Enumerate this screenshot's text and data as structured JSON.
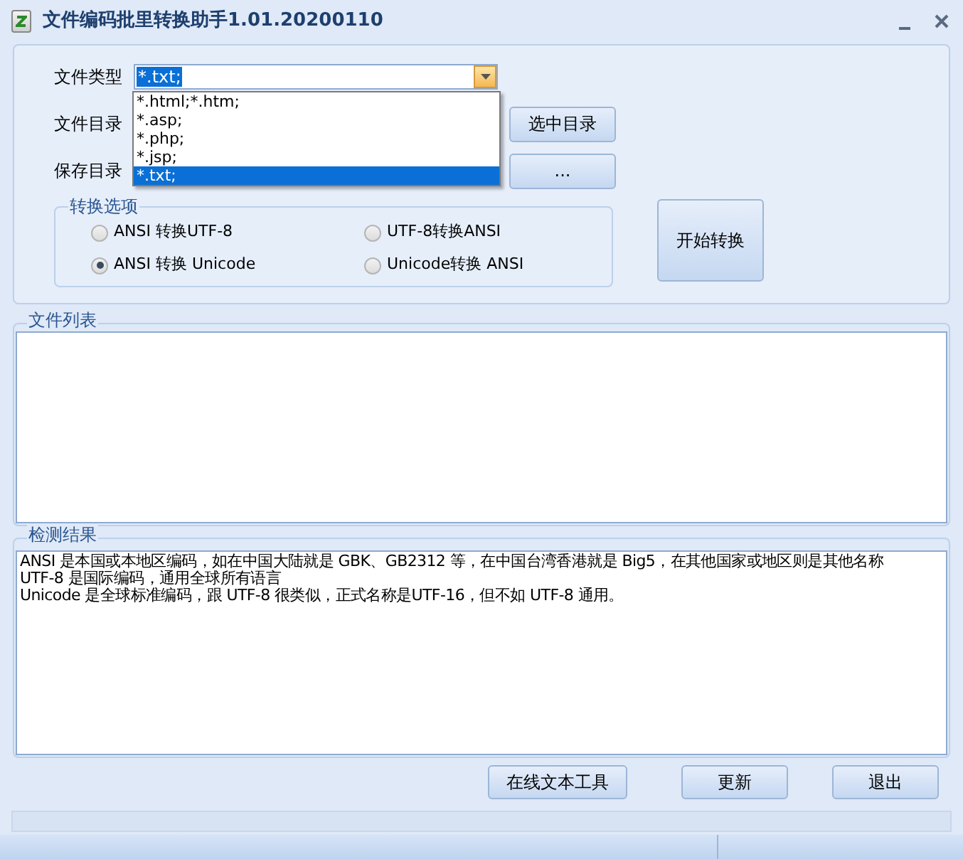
{
  "window": {
    "title": "文件编码批里转换助手1.01.20200110"
  },
  "file_type": {
    "label": "文件类型",
    "value": "*.txt;",
    "dropdown": [
      {
        "label": "*.html;*.htm;",
        "selected": false
      },
      {
        "label": "*.asp;",
        "selected": false
      },
      {
        "label": "*.php;",
        "selected": false
      },
      {
        "label": "*.jsp;",
        "selected": false
      },
      {
        "label": "*.txt;",
        "selected": true
      }
    ]
  },
  "file_dir": {
    "label": "文件目录",
    "button": "选中目录"
  },
  "save_dir": {
    "label": "保存目录",
    "button": "..."
  },
  "options": {
    "title": "转换选项",
    "radios": [
      {
        "label": "ANSI 转换UTF-8",
        "selected": false
      },
      {
        "label": "UTF-8转换ANSI",
        "selected": false
      },
      {
        "label": "ANSI 转换 Unicode",
        "selected": true
      },
      {
        "label": "Unicode转换 ANSI",
        "selected": false
      }
    ]
  },
  "start_button": "开始转换",
  "file_list": {
    "title": "文件列表"
  },
  "results": {
    "title": "检测结果",
    "lines": [
      "ANSI 是本国或本地区编码，如在中国大陆就是 GBK、GB2312 等，在中国台湾香港就是 Big5，在其他国家或地区则是其他名称",
      "UTF-8 是国际编码，通用全球所有语言",
      "Unicode 是全球标准编码，跟 UTF-8 很类似，正式名称是UTF-16，但不如 UTF-8 通用。"
    ]
  },
  "bottom_buttons": [
    "在线文本工具",
    "更新",
    "退出"
  ]
}
